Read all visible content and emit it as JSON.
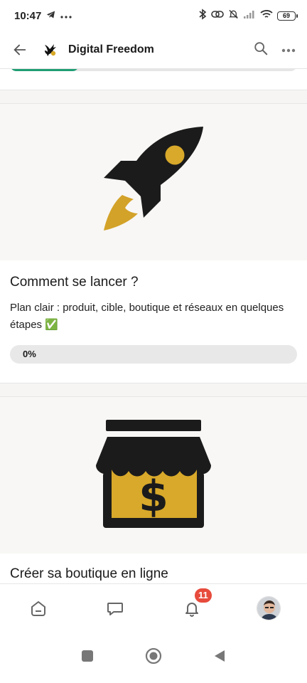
{
  "status_bar": {
    "time": "10:47",
    "battery": "69",
    "icons": [
      "telegram-icon",
      "more-dots-icon",
      "bluetooth-icon",
      "link-icon",
      "bell-muted-icon",
      "signal-icon",
      "wifi-icon",
      "battery-icon"
    ]
  },
  "header": {
    "title": "Digital Freedom",
    "icons": [
      "back-arrow-icon",
      "bird-logo-icon",
      "search-icon",
      "more-icon"
    ]
  },
  "top_card": {
    "progress_fraction": 0.24,
    "fill_color": "#1f9e74"
  },
  "cards": [
    {
      "illustration": "rocket-icon",
      "title": "Comment se lancer ?",
      "description": "Plan clair : produit, cible, boutique et réseaux en quelques étapes ✅",
      "progress": "0%"
    },
    {
      "illustration": "storefront-dollar-icon",
      "title": "Créer sa boutique en ligne"
    }
  ],
  "bottom_nav": {
    "items": [
      "home-icon",
      "chat-icon",
      "bell-icon",
      "avatar"
    ],
    "notification_count": "11",
    "badge_color": "#e74b3c"
  },
  "system_nav": [
    "square-button",
    "home-circle-button",
    "back-triangle-button"
  ],
  "colors": {
    "gold": "#d8a92a",
    "dark": "#1a1a1a",
    "accent_green": "#1f9e74"
  }
}
